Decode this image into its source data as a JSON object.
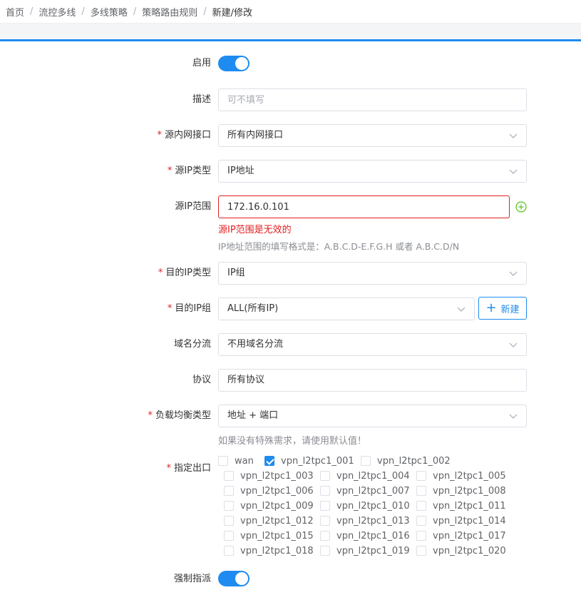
{
  "breadcrumb": [
    "首页",
    "流控多线",
    "多线策略",
    "策略路由规则",
    "新建/修改"
  ],
  "breadcrumb_sep": "/",
  "form": {
    "enable": {
      "label": "启用",
      "on": true
    },
    "description": {
      "label": "描述",
      "placeholder": "可不填写",
      "value": ""
    },
    "src_iface": {
      "label": "源内网接口",
      "required": true,
      "value": "所有内网接口"
    },
    "src_ip_type": {
      "label": "源IP类型",
      "required": true,
      "value": "IP地址"
    },
    "src_ip_range": {
      "label": "源IP范围",
      "value": "172.16.0.101",
      "error": "源IP范围是无效的",
      "hint": "IP地址范围的填写格式是：A.B.C.D-E.F.G.H 或者 A.B.C.D/N"
    },
    "dst_ip_type": {
      "label": "目的IP类型",
      "required": true,
      "value": "IP组"
    },
    "dst_ip_group": {
      "label": "目的IP组",
      "required": true,
      "value": "ALL(所有IP)",
      "new_button": "新建"
    },
    "domain_split": {
      "label": "域名分流",
      "value": "不用域名分流"
    },
    "protocol": {
      "label": "协议",
      "value": "所有协议"
    },
    "lb_type": {
      "label": "负载均衡类型",
      "required": true,
      "value": "地址 + 端口",
      "hint": "如果没有特殊需求，请使用默认值！"
    },
    "exit": {
      "label": "指定出口",
      "required": true,
      "options": [
        {
          "name": "wan",
          "checked": false
        },
        {
          "name": "vpn_l2tpc1_001",
          "checked": true
        },
        {
          "name": "vpn_l2tpc1_002",
          "checked": false
        },
        {
          "name": "vpn_l2tpc1_003",
          "checked": false
        },
        {
          "name": "vpn_l2tpc1_004",
          "checked": false
        },
        {
          "name": "vpn_l2tpc1_005",
          "checked": false
        },
        {
          "name": "vpn_l2tpc1_006",
          "checked": false
        },
        {
          "name": "vpn_l2tpc1_007",
          "checked": false
        },
        {
          "name": "vpn_l2tpc1_008",
          "checked": false
        },
        {
          "name": "vpn_l2tpc1_009",
          "checked": false
        },
        {
          "name": "vpn_l2tpc1_010",
          "checked": false
        },
        {
          "name": "vpn_l2tpc1_011",
          "checked": false
        },
        {
          "name": "vpn_l2tpc1_012",
          "checked": false
        },
        {
          "name": "vpn_l2tpc1_013",
          "checked": false
        },
        {
          "name": "vpn_l2tpc1_014",
          "checked": false
        },
        {
          "name": "vpn_l2tpc1_015",
          "checked": false
        },
        {
          "name": "vpn_l2tpc1_016",
          "checked": false
        },
        {
          "name": "vpn_l2tpc1_017",
          "checked": false
        },
        {
          "name": "vpn_l2tpc1_018",
          "checked": false
        },
        {
          "name": "vpn_l2tpc1_019",
          "checked": false
        },
        {
          "name": "vpn_l2tpc1_020",
          "checked": false
        }
      ]
    },
    "force_assign": {
      "label": "强制指派",
      "on": true
    }
  },
  "colors": {
    "primary": "#1e8bf0",
    "error": "#e02020",
    "success": "#52c41a",
    "label": "#333333",
    "hint": "#8a8d93"
  },
  "icons": {
    "chevron": "chevron-down-icon",
    "add_range": "plus-circle-icon",
    "new": "plus-icon"
  }
}
